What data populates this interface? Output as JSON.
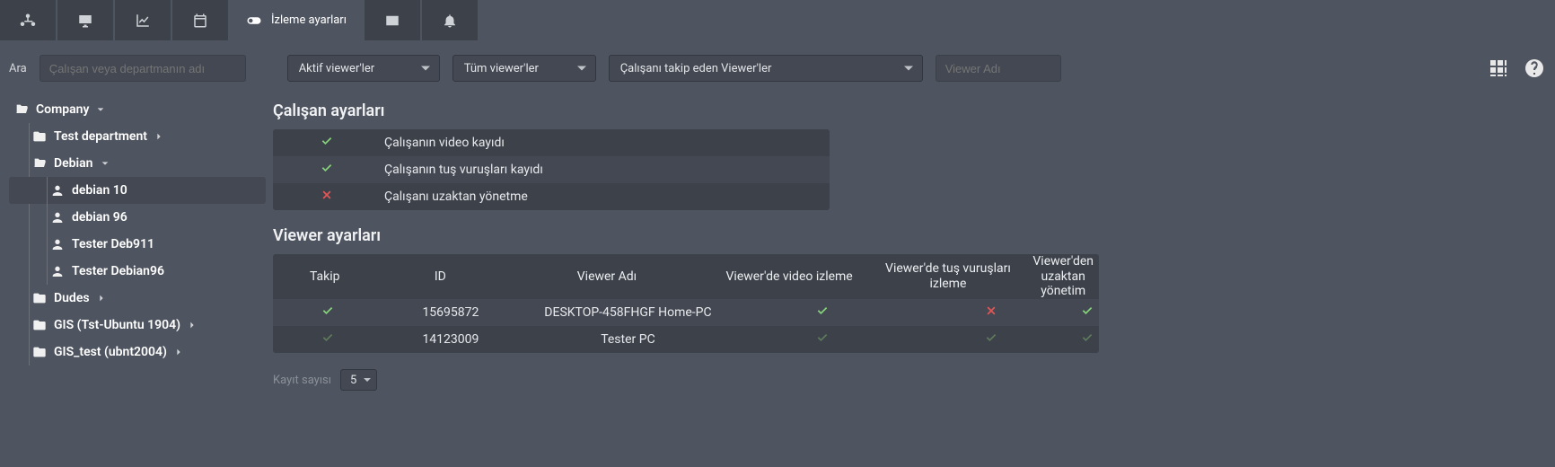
{
  "tabs": {
    "active_label": "İzleme ayarları"
  },
  "search": {
    "label": "Ara",
    "placeholder": "Çalışan veya departmanın adı"
  },
  "filters": {
    "active_viewers": "Aktif viewer'ler",
    "all_viewers": "Tüm viewer'ler",
    "tracking_viewers": "Çalışanı takip eden Viewer'ler",
    "viewer_name_placeholder": "Viewer Adı"
  },
  "tree": {
    "root": "Company",
    "items": [
      {
        "label": "Test department",
        "type": "folder",
        "expand": "right"
      },
      {
        "label": "Debian",
        "type": "folder-open",
        "expand": "down",
        "children": [
          {
            "label": "debian 10",
            "type": "user",
            "selected": true
          },
          {
            "label": "debian 96",
            "type": "user"
          },
          {
            "label": "Tester Deb911",
            "type": "user"
          },
          {
            "label": "Tester Debian96",
            "type": "user"
          }
        ]
      },
      {
        "label": "Dudes",
        "type": "folder",
        "expand": "right"
      },
      {
        "label": "GIS (Tst-Ubuntu 1904)",
        "type": "folder",
        "expand": "right"
      },
      {
        "label": "GIS_test (ubnt2004)",
        "type": "folder",
        "expand": "right"
      }
    ]
  },
  "employee_section": {
    "title": "Çalışan ayarları",
    "rows": [
      {
        "status": "check",
        "label": "Çalışanın video kayıdı"
      },
      {
        "status": "check",
        "label": "Çalışanın tuş vuruşları kayıdı"
      },
      {
        "status": "cross",
        "label": "Çalışanı uzaktan yönetme"
      }
    ]
  },
  "viewer_section": {
    "title": "Viewer ayarları",
    "columns": {
      "track": "Takip",
      "id": "ID",
      "name": "Viewer Adı",
      "video": "Viewer'de video izleme",
      "keys": "Viewer'de tuş vuruşları izleme",
      "remote": "Viewer'den uzaktan yönetim"
    },
    "rows": [
      {
        "track": "check",
        "id": "15695872",
        "name": "DESKTOP-458FHGF Home-PC",
        "video": "check",
        "keys": "cross",
        "remote": "check"
      },
      {
        "track": "check-dim",
        "id": "14123009",
        "name": "Tester PC",
        "video": "check-dim",
        "keys": "check-dim",
        "remote": "check-dim"
      }
    ]
  },
  "pager": {
    "label": "Kayıt sayısı",
    "value": "5"
  }
}
